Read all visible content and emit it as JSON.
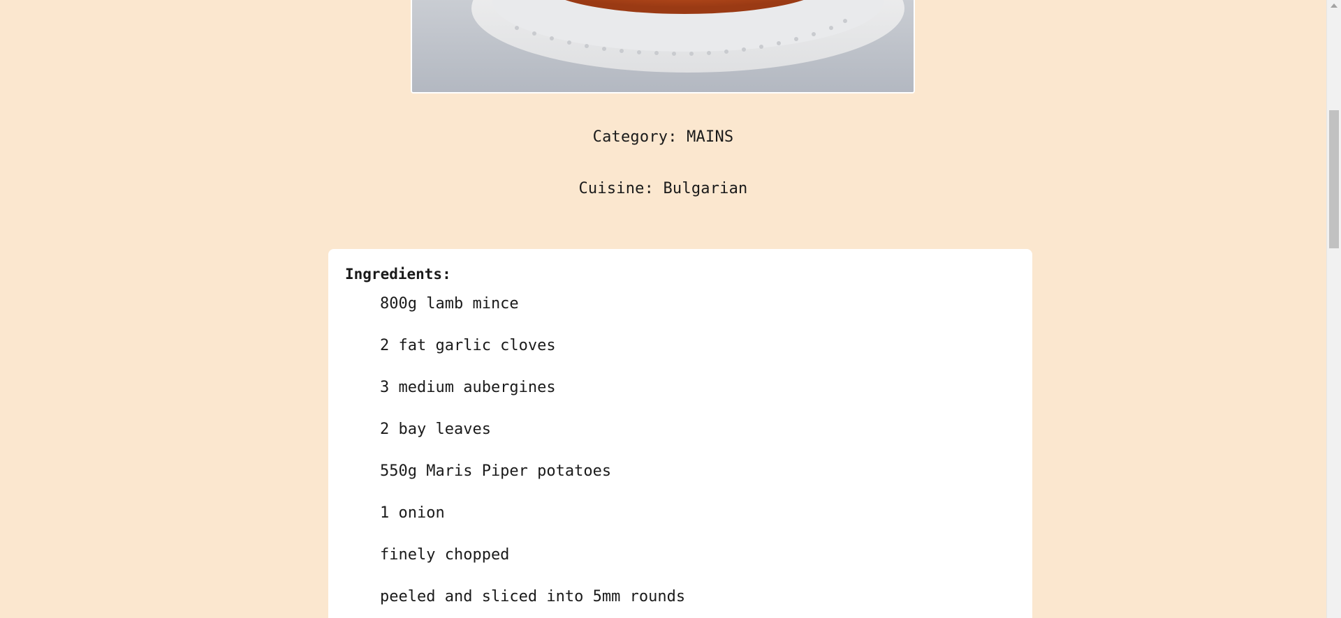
{
  "recipe": {
    "image_alt": "moussaka dish on white plate",
    "category": "Category: MAINS",
    "cuisine": "Cuisine: Bulgarian"
  },
  "ingredients": {
    "title": "Ingredients:",
    "items": [
      "800g lamb mince",
      "2 fat garlic cloves",
      "3 medium aubergines",
      "2 bay leaves",
      "550g Maris Piper potatoes",
      "1 onion",
      "finely chopped",
      "peeled and sliced into 5mm rounds"
    ]
  },
  "colors": {
    "background": "#fbe7cf",
    "card": "#ffffff",
    "text": "#1a1a1a"
  }
}
